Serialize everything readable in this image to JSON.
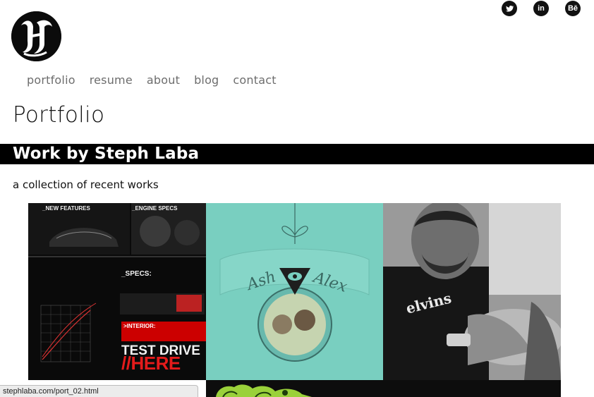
{
  "social": {
    "twitter": "twitter-icon",
    "linkedin_label": "in",
    "behance_label": "Bē"
  },
  "nav": {
    "items": [
      "portfolio",
      "resume",
      "about",
      "blog",
      "contact"
    ]
  },
  "page": {
    "title": "Portfolio",
    "band_title": "Work by Steph Laba",
    "subtitle": "a collection of recent works"
  },
  "tiles": {
    "audi": {
      "new_features": "_NEW FEATURES",
      "engine_specs": "_ENGINE SPECS",
      "specs": "_SPECS:",
      "interior": ">INTERIOR:",
      "test_drive": "TEST DRIVE",
      "here": "//HERE"
    },
    "ash_alex": {
      "left_name": "Ash",
      "right_name": "Alex"
    },
    "tattoo": {
      "shirt_text": "elvins"
    }
  },
  "status_bar": {
    "url": "stephlaba.com/port_02.html"
  },
  "colors": {
    "band": "#000000",
    "nav_text": "#6d6d6d",
    "teal": "#79cfc0",
    "accent_red": "#e51b1b"
  }
}
